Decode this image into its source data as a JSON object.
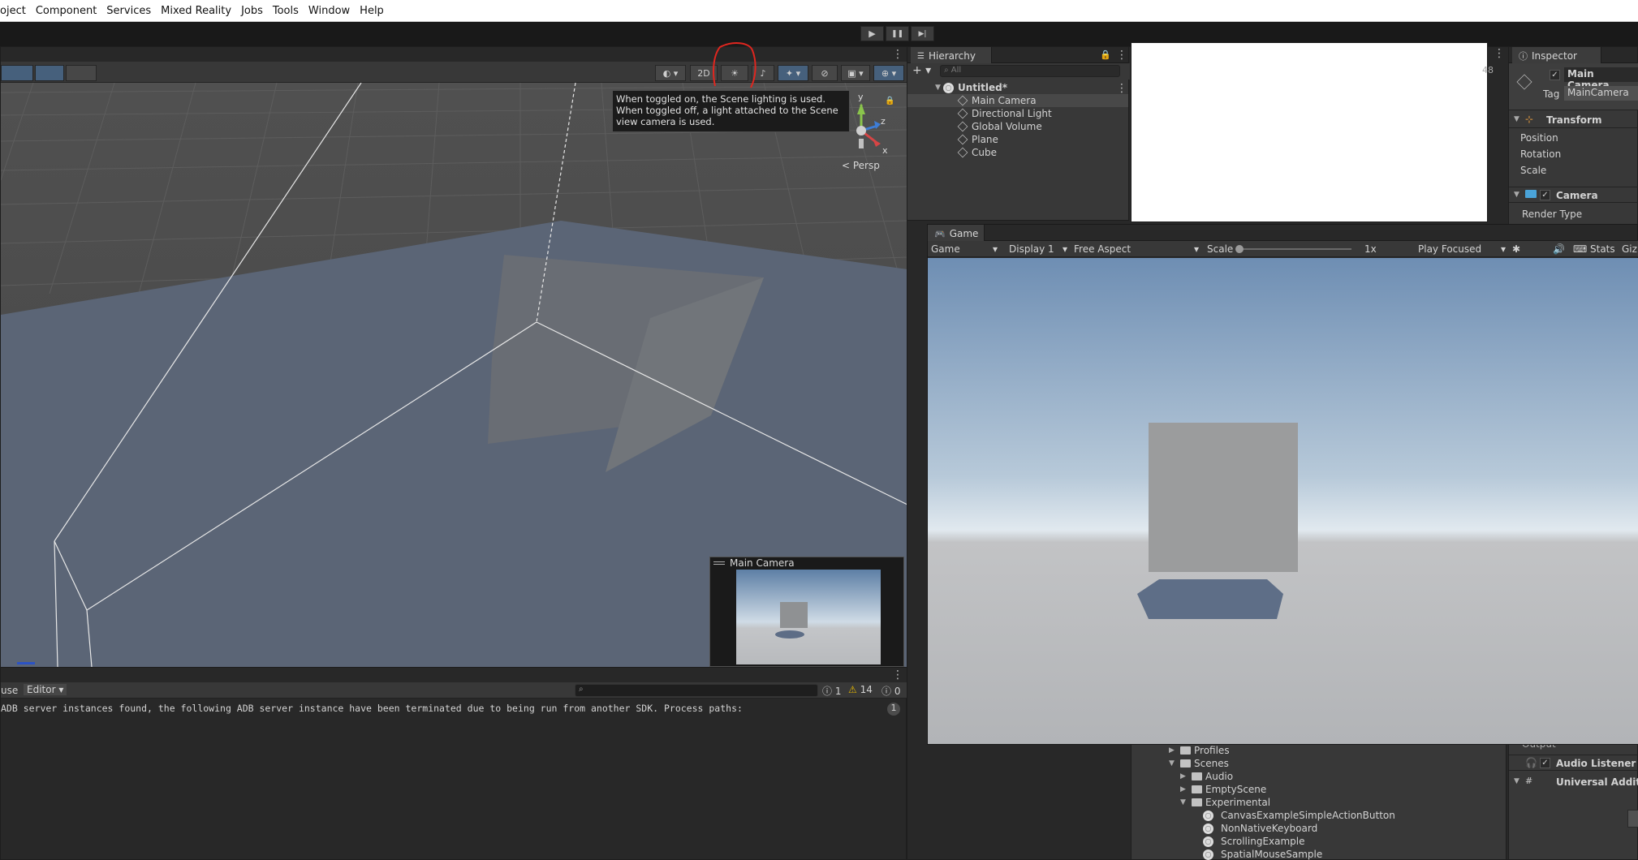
{
  "menubar": {
    "items": [
      "oject",
      "Component",
      "Services",
      "Mixed Reality",
      "Jobs",
      "Tools",
      "Window",
      "Help"
    ]
  },
  "play_controls": {
    "play": "▶",
    "pause": "❚❚",
    "step": "▶|"
  },
  "scene_view": {
    "btn_2d": "2D",
    "tooltip": "When toggled on, the Scene lighting is used. When toggled off, a light attached to the Scene view camera is used.",
    "persp_label": "< Persp",
    "gizmo_axes": {
      "y": "y",
      "z": "z",
      "x": "x"
    },
    "camera_preview_title": "Main Camera",
    "annotation_color": "#e0261f"
  },
  "hierarchy": {
    "tab_label": "Hierarchy",
    "search_placeholder": "All",
    "scene_name": "Untitled*",
    "items": [
      "Main Camera",
      "Directional Light",
      "Global Volume",
      "Plane",
      "Cube"
    ]
  },
  "inspector": {
    "tab_label": "Inspector",
    "object_name": "Main Camera",
    "tag_label": "Tag",
    "tag_value": "MainCamera",
    "sub_count": "48",
    "transform": {
      "title": "Transform",
      "fields": [
        "Position",
        "Rotation",
        "Scale"
      ]
    },
    "camera": {
      "title": "Camera",
      "render_type_label": "Render Type"
    },
    "partial_label": "Output",
    "audio_listener": "Audio Listener",
    "universal_additional": "Universal Additic"
  },
  "game_view": {
    "tab_label": "Game",
    "mode_select": "Game",
    "display_select": "Display 1",
    "aspect_select": "Free Aspect",
    "scale_label": "Scale",
    "scale_value": "1x",
    "play_focus_select": "Play Focused",
    "stats_label": "Stats",
    "gizmos_label": "Giz"
  },
  "console": {
    "left_label": "use",
    "editor_select": "Editor",
    "count_errors": "1",
    "count_warnings": "14",
    "count_messages": "0",
    "message": "ADB server instances found, the following ADB server instance have been terminated due to being run from another SDK. Process paths:",
    "message_count": "1"
  },
  "project": {
    "rows": [
      {
        "label": "Profiles",
        "indent": 0,
        "expanded": false,
        "type": "folder"
      },
      {
        "label": "Scenes",
        "indent": 0,
        "expanded": true,
        "type": "folder"
      },
      {
        "label": "Audio",
        "indent": 1,
        "expanded": false,
        "type": "folder"
      },
      {
        "label": "EmptyScene",
        "indent": 1,
        "expanded": false,
        "type": "folder"
      },
      {
        "label": "Experimental",
        "indent": 1,
        "expanded": true,
        "type": "folder"
      },
      {
        "label": "CanvasExampleSimpleActionButton",
        "indent": 2,
        "type": "scene"
      },
      {
        "label": "NonNativeKeyboard",
        "indent": 2,
        "type": "scene"
      },
      {
        "label": "ScrollingExample",
        "indent": 2,
        "type": "scene"
      },
      {
        "label": "SpatialMouseSample",
        "indent": 2,
        "type": "scene"
      }
    ]
  }
}
